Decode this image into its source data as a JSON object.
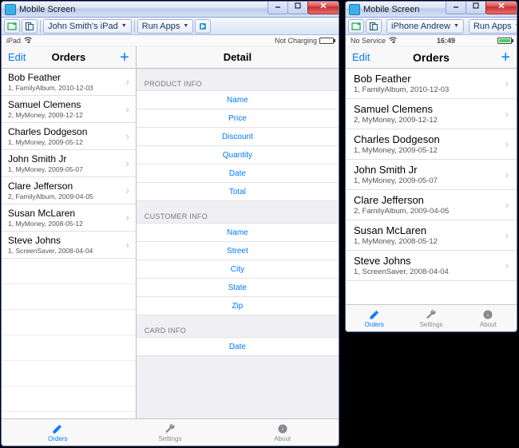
{
  "windows": {
    "left": {
      "title": "Mobile Screen"
    },
    "right": {
      "title": "Mobile Screen"
    }
  },
  "toolbar": {
    "device_left": "John Smith's iPad",
    "device_right": "iPhone Andrew",
    "run_apps": "Run Apps"
  },
  "status": {
    "left_device": "iPad",
    "left_charge": "Not Charging",
    "right_carrier": "No Service",
    "right_time": "16:49"
  },
  "nav": {
    "edit": "Edit",
    "orders_title": "Orders",
    "detail_title": "Detail"
  },
  "orders": [
    {
      "name": "Bob Feather",
      "sub": "1, FamilyAlbum, 2010-12-03"
    },
    {
      "name": "Samuel Clemens",
      "sub": "2, MyMoney, 2009-12-12"
    },
    {
      "name": "Charles Dodgeson",
      "sub": "1, MyMoney, 2009-05-12"
    },
    {
      "name": "John Smith Jr",
      "sub": "1, MyMoney, 2009-05-07"
    },
    {
      "name": "Clare Jefferson",
      "sub": "2, FamilyAlbum, 2009-04-05"
    },
    {
      "name": "Susan McLaren",
      "sub": "1, MyMoney, 2008-05-12"
    },
    {
      "name": "Steve Johns",
      "sub": "1, ScreenSaver, 2008-04-04"
    }
  ],
  "detail": {
    "product_hdr": "PRODUCT INFO",
    "customer_hdr": "CUSTOMER INFO",
    "card_hdr": "CARD INFO",
    "product": [
      "Name",
      "Price",
      "Discount",
      "Quantity",
      "Date",
      "Total"
    ],
    "customer": [
      "Name",
      "Street",
      "City",
      "State",
      "Zip"
    ],
    "card": [
      "Date"
    ]
  },
  "tabs": {
    "orders": "Orders",
    "settings": "Settings",
    "about": "About"
  }
}
